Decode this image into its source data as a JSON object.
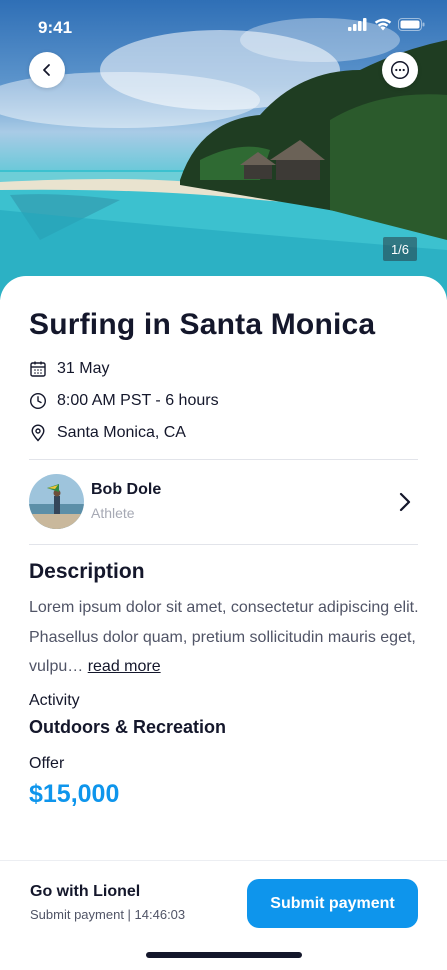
{
  "status_bar": {
    "time": "9:41"
  },
  "hero": {
    "photo_counter": "1/6"
  },
  "event": {
    "title": "Surfing in Santa Monica",
    "date": "31 May",
    "time": "8:00 AM PST - 6 hours",
    "location": "Santa Monica, CA"
  },
  "host": {
    "name": "Bob Dole",
    "role": "Athlete"
  },
  "description": {
    "heading": "Description",
    "text": "Lorem ipsum dolor sit amet, consectetur adipiscing elit. Phasellus dolor quam, pretium sollicitudin mauris eget, vulpu…",
    "read_more": "read more"
  },
  "activity": {
    "label": "Activity",
    "value": "Outdoors & Recreation"
  },
  "offer": {
    "label": "Offer",
    "value": "$15,000"
  },
  "footer": {
    "title": "Go with Lionel",
    "subtitle": "Submit payment | 14:46:03",
    "button_label": "Submit payment"
  },
  "colors": {
    "accent": "#0e95ec",
    "text": "#14172b",
    "muted": "#a6a9b4"
  },
  "icons": [
    "back-icon",
    "more-icon",
    "calendar-icon",
    "clock-icon",
    "location-pin-icon",
    "chevron-right-icon",
    "signal-icon",
    "wifi-icon",
    "battery-icon"
  ]
}
